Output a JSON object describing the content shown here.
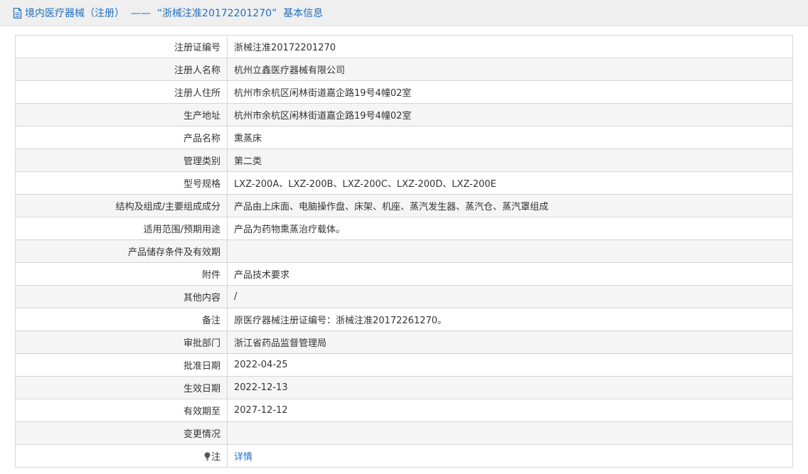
{
  "header": {
    "title": "境内医疗器械（注册）  ——  “浙械注准20172201270”  基本信息",
    "icon": "document-icon"
  },
  "rows": [
    {
      "label": "注册证编号",
      "value": "浙械注准20172201270"
    },
    {
      "label": "注册人名称",
      "value": "杭州立鑫医疗器械有限公司"
    },
    {
      "label": "注册人住所",
      "value": "杭州市余杭区闲林街道嘉企路19号4幢02室"
    },
    {
      "label": "生产地址",
      "value": "杭州市余杭区闲林街道嘉企路19号4幢02室"
    },
    {
      "label": "产品名称",
      "value": "熏蒸床"
    },
    {
      "label": "管理类别",
      "value": "第二类"
    },
    {
      "label": "型号规格",
      "value": "LXZ-200A、LXZ-200B、LXZ-200C、LXZ-200D、LXZ-200E"
    },
    {
      "label": "结构及组成/主要组成成分",
      "value": "产品由上床面、电脑操作盘、床架、机座、蒸汽发生器、蒸汽仓、蒸汽罩组成"
    },
    {
      "label": "适用范围/预期用途",
      "value": "产品为药物熏蒸治疗载体。"
    },
    {
      "label": "产品储存条件及有效期",
      "value": ""
    },
    {
      "label": "附件",
      "value": "产品技术要求"
    },
    {
      "label": "其他内容",
      "value": "/"
    },
    {
      "label": "备注",
      "value": "原医疗器械注册证编号：浙械注准20172261270。"
    },
    {
      "label": "审批部门",
      "value": "浙江省药品监督管理局"
    },
    {
      "label": "批准日期",
      "value": "2022-04-25"
    },
    {
      "label": "生效日期",
      "value": "2022-12-13"
    },
    {
      "label": "有效期至",
      "value": "2027-12-12"
    },
    {
      "label": "变更情况",
      "value": ""
    }
  ],
  "note": {
    "label": "注",
    "icon": "lightbulb-icon",
    "link_text": "详情"
  },
  "colors": {
    "accent": "#1f6fbf",
    "header_bg": "#efefef",
    "row_alt_bg": "#f5f5f5",
    "border": "#d6d6d6"
  }
}
